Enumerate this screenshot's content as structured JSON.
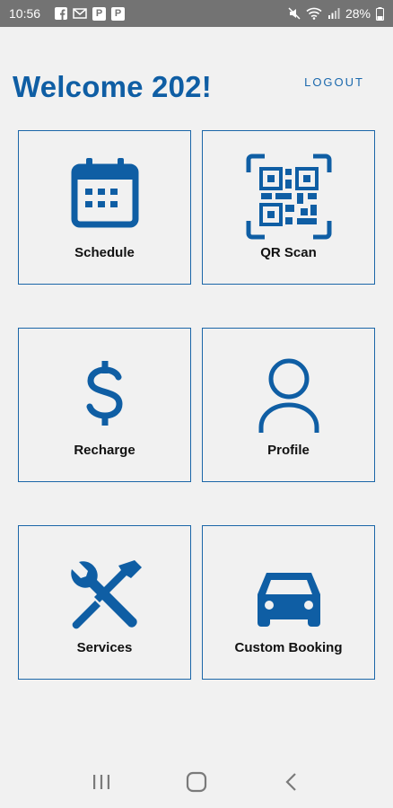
{
  "status_bar": {
    "time": "10:56",
    "notif_box_1": "P",
    "notif_box_2": "P",
    "battery": "28%"
  },
  "header": {
    "welcome": "Welcome 202!",
    "logout_label": "LOGOUT"
  },
  "tiles": [
    {
      "label": "Schedule",
      "icon": "calendar-icon"
    },
    {
      "label": "QR Scan",
      "icon": "qr-code-icon"
    },
    {
      "label": "Recharge",
      "icon": "dollar-icon"
    },
    {
      "label": "Profile",
      "icon": "person-icon"
    },
    {
      "label": "Services",
      "icon": "tools-icon"
    },
    {
      "label": "Custom Booking",
      "icon": "car-icon"
    }
  ],
  "colors": {
    "accent": "#0f5ea4",
    "tile_border": "#1b66a8",
    "background": "#f1f1f1",
    "status_bar": "#737373"
  }
}
